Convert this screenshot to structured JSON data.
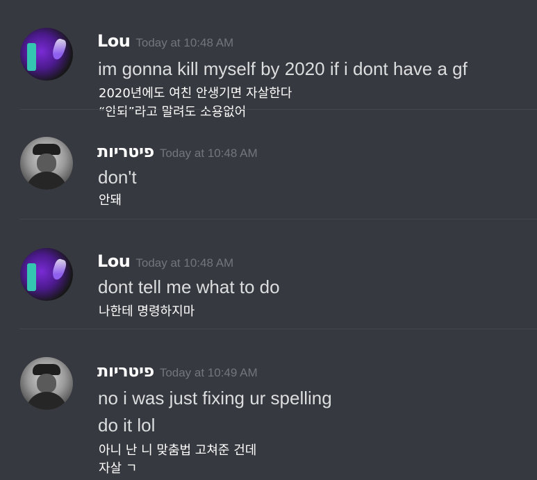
{
  "messages": [
    {
      "author": "Lou",
      "time": "Today at 10:48 AM",
      "lines": [
        "im gonna kill myself by 2020 if  i dont have a gf"
      ],
      "translation": [
        "2020년에도 여친 안생기면 자살한다",
        "“안되”라고 말려도 소용없어"
      ]
    },
    {
      "author": "פיטריות",
      "time": "Today at 10:48 AM",
      "lines": [
        "don't"
      ],
      "translation": [
        "안돼"
      ]
    },
    {
      "author": "Lou",
      "time": "Today at 10:48 AM",
      "lines": [
        "dont tell me what to do"
      ],
      "translation": [
        "나한테 명령하지마"
      ]
    },
    {
      "author": "פיטריות",
      "time": "Today at 10:49 AM",
      "lines": [
        "no i was just fixing ur spelling",
        "do it lol"
      ],
      "translation": [
        "아니 난 니 맞춤법 고쳐준 건데",
        "자살 ㄱ"
      ]
    }
  ],
  "colors": {
    "background": "#36393f",
    "username": "#ffffff",
    "timestamp": "#72767d",
    "message_text": "#dcddde",
    "translation_text": "#ffffff"
  }
}
